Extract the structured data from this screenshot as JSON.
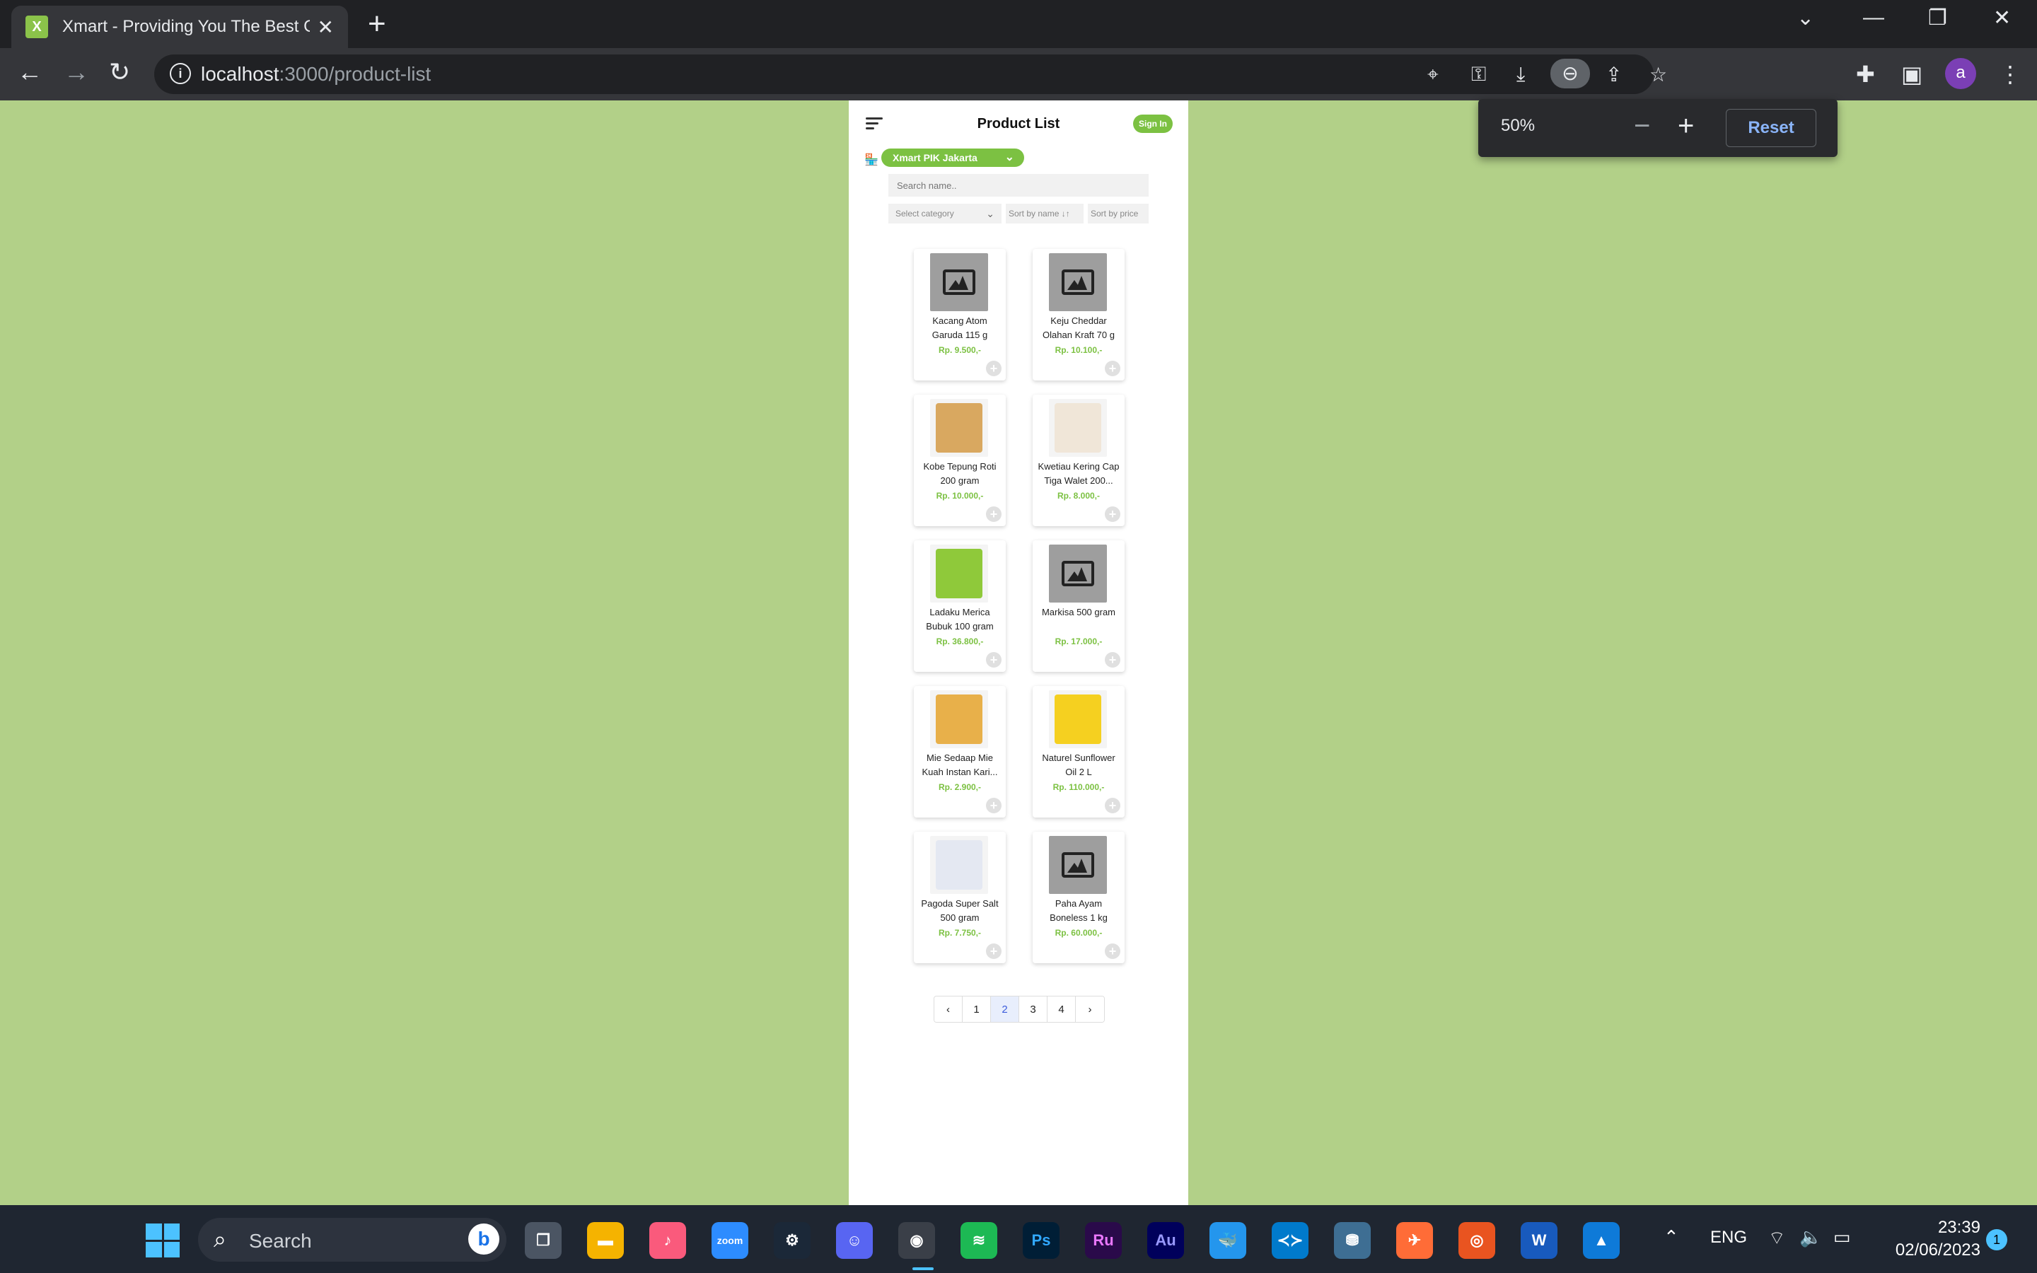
{
  "browser": {
    "tab_title": "Xmart - Providing You The Best Groceries",
    "favicon_letter": "X",
    "url_host": "localhost",
    "url_path": ":3000/product-list",
    "profile_initial": "a"
  },
  "zoom_popup": {
    "level": "50%",
    "minus": "−",
    "plus": "+",
    "reset_label": "Reset"
  },
  "app": {
    "title": "Product List",
    "signin_label": "Sign In",
    "store_name": "Xmart PIK Jakarta",
    "search_placeholder": "Search name..",
    "category_placeholder": "Select category",
    "sort_name_label": "Sort by name ↓↑",
    "sort_price_label": "Sort by price",
    "accent_color": "#7cc142"
  },
  "products": [
    {
      "name": "Kacang Atom Garuda 115 g",
      "price": "Rp. 9.500,-",
      "image": "placeholder"
    },
    {
      "name": "Keju Cheddar Olahan Kraft 70 g",
      "price": "Rp. 10.100,-",
      "image": "placeholder"
    },
    {
      "name": "Kobe Tepung Roti 200 gram",
      "price": "Rp. 10.000,-",
      "image": "photo"
    },
    {
      "name": "Kwetiau Kering Cap Tiga Walet 200...",
      "price": "Rp. 8.000,-",
      "image": "photo"
    },
    {
      "name": "Ladaku Merica Bubuk 100 gram",
      "price": "Rp. 36.800,-",
      "image": "photo"
    },
    {
      "name": "Markisa 500 gram",
      "price": "Rp. 17.000,-",
      "image": "placeholder"
    },
    {
      "name": "Mie Sedaap Mie Kuah Instan Kari...",
      "price": "Rp. 2.900,-",
      "image": "photo"
    },
    {
      "name": "Naturel Sunflower Oil 2 L",
      "price": "Rp. 110.000,-",
      "image": "photo"
    },
    {
      "name": "Pagoda Super Salt 500 gram",
      "price": "Rp. 7.750,-",
      "image": "photo"
    },
    {
      "name": "Paha Ayam Boneless 1 kg",
      "price": "Rp. 60.000,-",
      "image": "placeholder"
    }
  ],
  "pagination": {
    "prev": "‹",
    "pages": [
      "1",
      "2",
      "3",
      "4"
    ],
    "current": "2",
    "next": "›"
  },
  "taskbar": {
    "search_label": "Search",
    "language": "ENG",
    "time": "23:39",
    "date": "02/06/2023",
    "notification_count": "1",
    "apps": [
      "file-explorer",
      "itunes",
      "zoom",
      "steam",
      "discord",
      "chrome",
      "spotify",
      "photoshop",
      "rush",
      "audition",
      "docker",
      "vscode",
      "mysql-workbench",
      "postman",
      "ubuntu",
      "word",
      "photos"
    ]
  }
}
